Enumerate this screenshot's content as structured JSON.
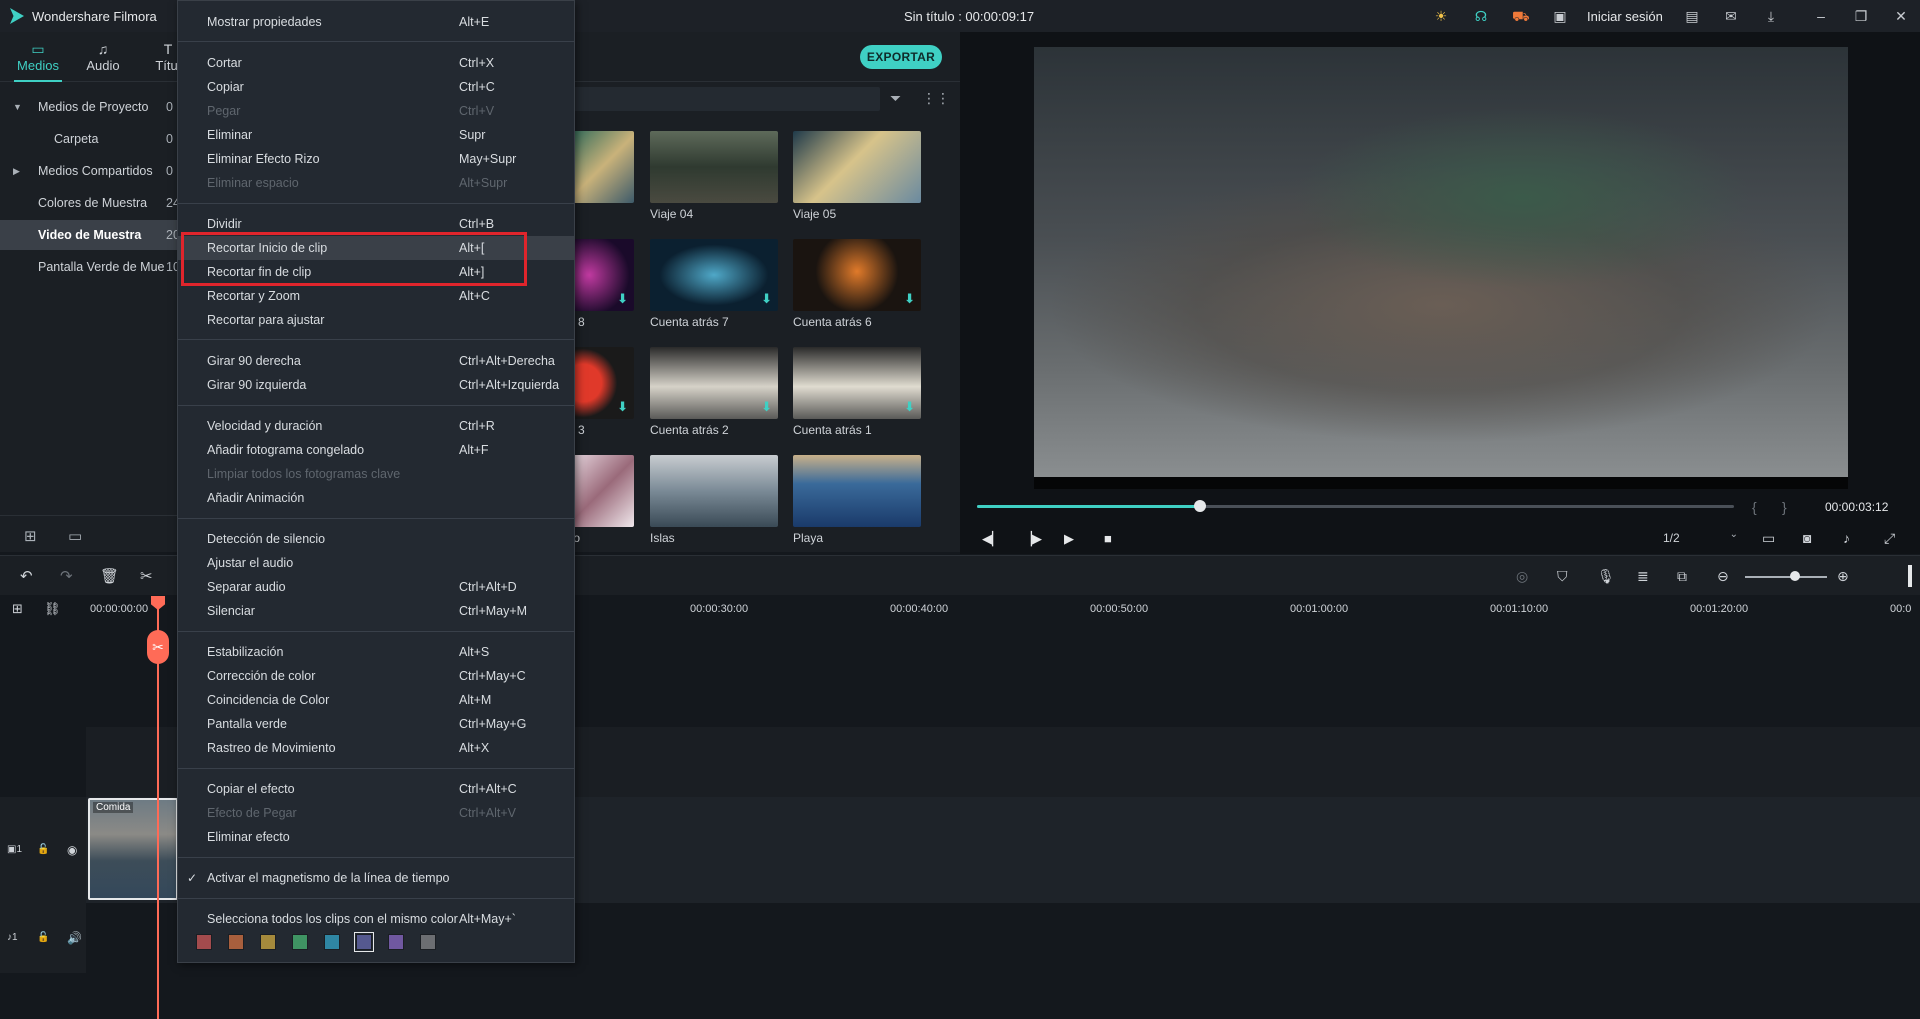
{
  "app": {
    "name": "Wondershare Filmora",
    "doc_title": "Sin título : 00:00:09:17",
    "sign_in": "Iniciar sesión"
  },
  "tabs": [
    {
      "label": "Medios",
      "icon": "folder-icon"
    },
    {
      "label": "Audio",
      "icon": "music-note-icon"
    },
    {
      "label": "Títul",
      "icon": "text-icon"
    }
  ],
  "tree": [
    {
      "label": "Medios de Proyecto",
      "count": "0"
    },
    {
      "label": "Carpeta",
      "count": "0"
    },
    {
      "label": "Medios Compartidos",
      "count": "0"
    },
    {
      "label": "Colores de Muestra",
      "count": "24"
    },
    {
      "label": "Video de Muestra",
      "count": "20"
    },
    {
      "label": "Pantalla Verde de Mue",
      "count": "10"
    }
  ],
  "export_label": "EXPORTAR",
  "thumbnails": [
    {
      "caption": ""
    },
    {
      "caption": "Viaje 04"
    },
    {
      "caption": "Viaje 05"
    },
    {
      "caption": "8"
    },
    {
      "caption": "Cuenta atrás 7"
    },
    {
      "caption": "Cuenta atrás 6"
    },
    {
      "caption": "3"
    },
    {
      "caption": "Cuenta atrás 2"
    },
    {
      "caption": "Cuenta atrás 1"
    },
    {
      "caption": "to"
    },
    {
      "caption": "Islas"
    },
    {
      "caption": "Playa"
    }
  ],
  "preview": {
    "time": "00:00:03:12",
    "progress": 0.295,
    "quality": "1/2",
    "brace_open": "{",
    "brace_close": "}"
  },
  "ruler": [
    "00:00:00:00",
    "00:00:30:00",
    "00:00:40:00",
    "00:00:50:00",
    "00:01:00:00",
    "00:01:10:00",
    "00:01:20:00",
    "00:0"
  ],
  "clip": {
    "label": "Comida"
  },
  "menu": [
    {
      "label": "Mostrar propiedades",
      "shortcut": "Alt+E"
    },
    {
      "label": "Cortar",
      "shortcut": "Ctrl+X"
    },
    {
      "label": "Copiar",
      "shortcut": "Ctrl+C"
    },
    {
      "label": "Pegar",
      "shortcut": "Ctrl+V"
    },
    {
      "label": "Eliminar",
      "shortcut": "Supr"
    },
    {
      "label": "Eliminar Efecto Rizo",
      "shortcut": "May+Supr"
    },
    {
      "label": "Eliminar espacio",
      "shortcut": "Alt+Supr"
    },
    {
      "label": "Dividir",
      "shortcut": "Ctrl+B"
    },
    {
      "label": "Recortar Inicio de clip",
      "shortcut": "Alt+["
    },
    {
      "label": "Recortar fin de clip",
      "shortcut": "Alt+]"
    },
    {
      "label": "Recortar y Zoom",
      "shortcut": "Alt+C"
    },
    {
      "label": "Recortar para ajustar",
      "shortcut": ""
    },
    {
      "label": "Girar 90 derecha",
      "shortcut": "Ctrl+Alt+Derecha"
    },
    {
      "label": "Girar 90 izquierda",
      "shortcut": "Ctrl+Alt+Izquierda"
    },
    {
      "label": "Velocidad y duración",
      "shortcut": "Ctrl+R"
    },
    {
      "label": "Añadir fotograma congelado",
      "shortcut": "Alt+F"
    },
    {
      "label": "Limpiar todos los fotogramas clave",
      "shortcut": ""
    },
    {
      "label": "Añadir Animación",
      "shortcut": ""
    },
    {
      "label": "Detección de silencio",
      "shortcut": ""
    },
    {
      "label": "Ajustar el audio",
      "shortcut": ""
    },
    {
      "label": "Separar audio",
      "shortcut": "Ctrl+Alt+D"
    },
    {
      "label": "Silenciar",
      "shortcut": "Ctrl+May+M"
    },
    {
      "label": "Estabilización",
      "shortcut": "Alt+S"
    },
    {
      "label": "Corrección de color",
      "shortcut": "Ctrl+May+C"
    },
    {
      "label": "Coincidencia de Color",
      "shortcut": "Alt+M"
    },
    {
      "label": "Pantalla verde",
      "shortcut": "Ctrl+May+G"
    },
    {
      "label": "Rastreo de Movimiento",
      "shortcut": "Alt+X"
    },
    {
      "label": "Copiar el efecto",
      "shortcut": "Ctrl+Alt+C"
    },
    {
      "label": "Efecto de Pegar",
      "shortcut": "Ctrl+Alt+V"
    },
    {
      "label": "Eliminar efecto",
      "shortcut": ""
    },
    {
      "label": "Activar el magnetismo de la línea de tiempo",
      "shortcut": ""
    },
    {
      "label": "Selecciona todos los clips con el mismo color",
      "shortcut": "Alt+May+`"
    }
  ],
  "color_swatches": [
    "#a34b4d",
    "#a85f3d",
    "#a58a3c",
    "#3f9463",
    "#2f86a3",
    "#55598f",
    "#7058a0",
    "#6c6e72"
  ],
  "colors": {
    "accent": "#3fd0c4",
    "playhead": "#ff6b57",
    "highlight": "#e0252c"
  }
}
